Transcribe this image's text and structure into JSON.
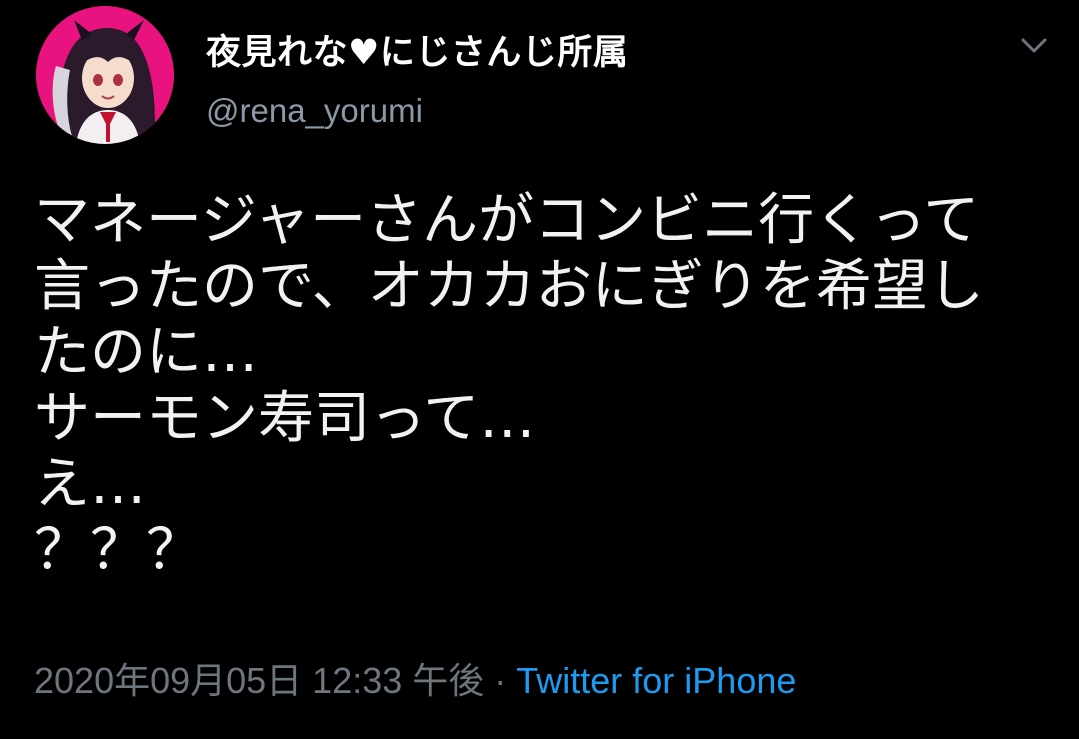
{
  "tweet": {
    "author": {
      "display_name": "夜見れな♥にじさんじ所属",
      "handle": "@rena_yorumi",
      "avatar_icon": "user-avatar-image"
    },
    "more_icon": "chevron-down-icon",
    "body_lines": [
      "マネージャーさんがコンビニ行くって",
      "言ったので、オカカおにぎりを希望し",
      "たのに…",
      "サーモン寿司って…",
      "え…",
      "？？？"
    ],
    "timestamp": "2020年09月05日 12:33 午後",
    "separator": "·",
    "source": "Twitter for iPhone"
  },
  "colors": {
    "background": "#000000",
    "display_name": "#ffffff",
    "handle": "#8b98a5",
    "body_text": "#f0f2f3",
    "meta_text": "#6e767d",
    "link": "#1d9bf0",
    "avatar_bg": "#e8137f"
  }
}
